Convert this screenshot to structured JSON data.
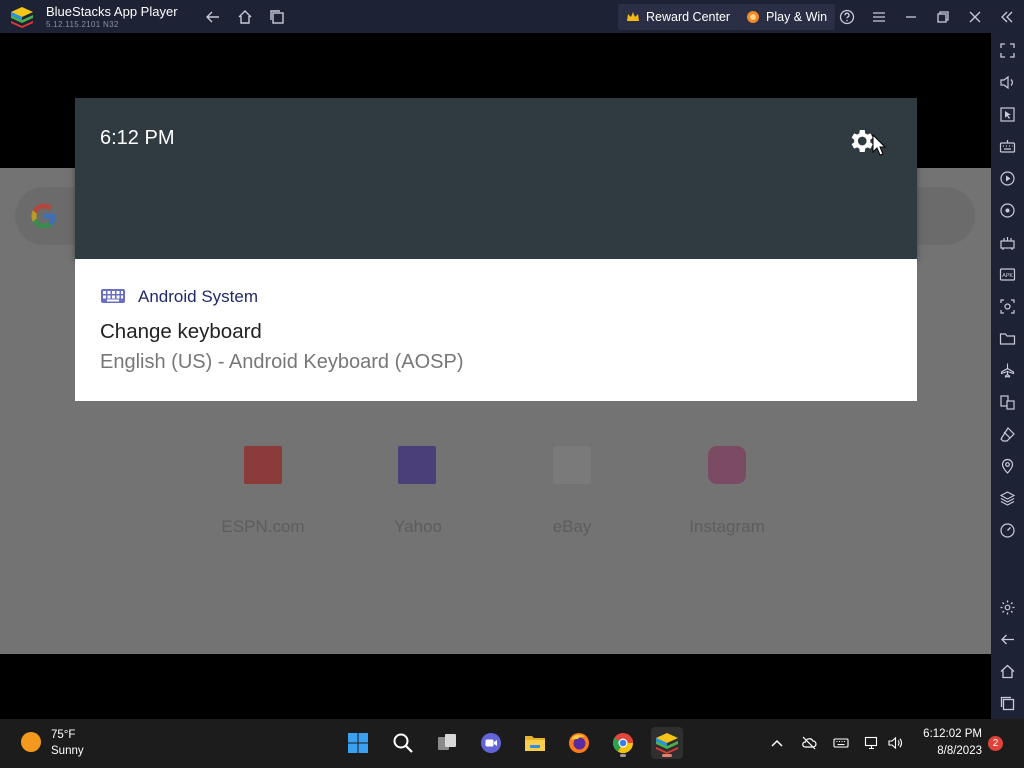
{
  "window": {
    "title": "BlueStacks App Player",
    "version": "5.12.115.2101  N32",
    "reward_center": "Reward Center",
    "play_win": "Play & Win"
  },
  "shade": {
    "time": "6:12 PM"
  },
  "notification": {
    "app_name": "Android System",
    "title": "Change keyboard",
    "text": "English (US) - Android Keyboard (AOSP)"
  },
  "home": {
    "shortcuts": [
      "ESPN.com",
      "Yahoo",
      "eBay",
      "Instagram"
    ]
  },
  "taskbar": {
    "weather_temp": "75°F",
    "weather_condition": "Sunny",
    "clock_time": "6:12:02 PM",
    "clock_date": "8/8/2023",
    "notification_count": "2"
  },
  "colors": {
    "titlebar": "#1e2235",
    "shade_header": "#2f3b41",
    "accent_app_name": "#1f2a6a"
  }
}
